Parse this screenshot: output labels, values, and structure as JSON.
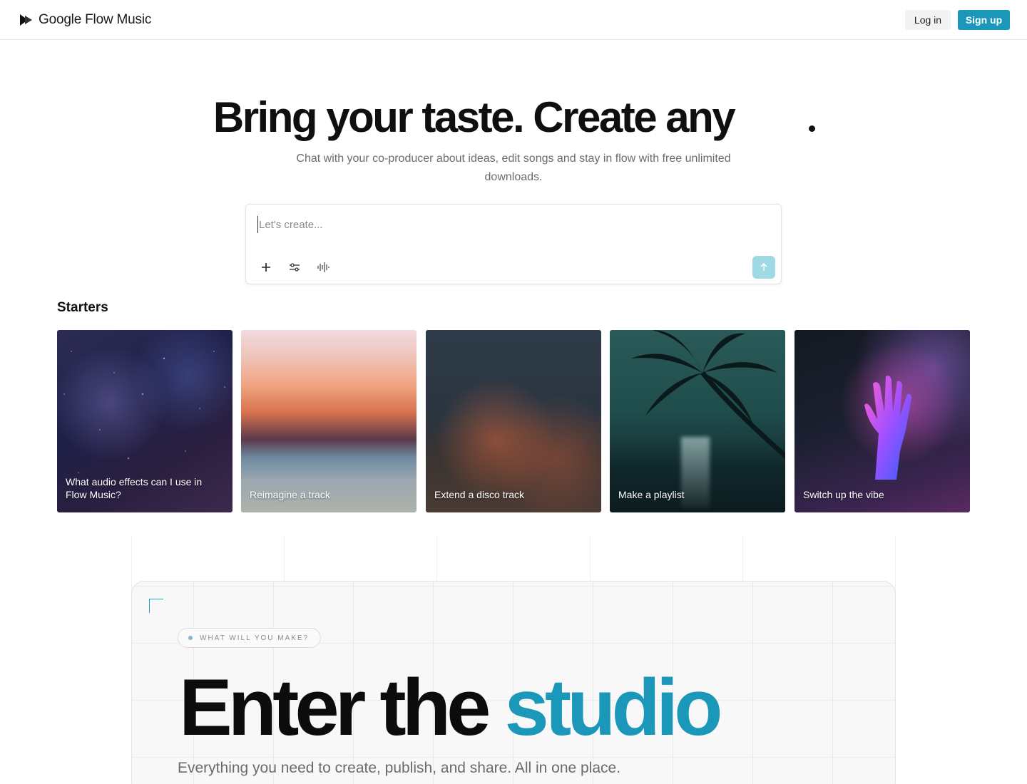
{
  "header": {
    "brand_name": "Google Flow Music",
    "login_label": "Log in",
    "signup_label": "Sign up"
  },
  "hero": {
    "title": "Bring your taste. Create any",
    "subtitle": "Chat with your co-producer about ideas, edit songs and stay in flow with free unlimited downloads."
  },
  "prompt": {
    "placeholder": "Let's create...",
    "tools": [
      "plus-icon",
      "tune-icon",
      "waveform-icon"
    ],
    "send_icon": "arrow-up-icon"
  },
  "starters": {
    "title": "Starters",
    "cards": [
      {
        "label": "What audio effects can I use in Flow Music?"
      },
      {
        "label": "Reimagine a track"
      },
      {
        "label": "Extend a disco track"
      },
      {
        "label": "Make a playlist"
      },
      {
        "label": "Switch up the vibe"
      }
    ]
  },
  "studio": {
    "eyebrow": "WHAT WILL YOU MAKE?",
    "title_part1": "Enter the",
    "title_part2": "studio",
    "subtitle": "Everything you need to create, publish, and share. All in one place."
  },
  "colors": {
    "accent": "#1a97b9",
    "send_disabled": "#9fd9e3"
  }
}
